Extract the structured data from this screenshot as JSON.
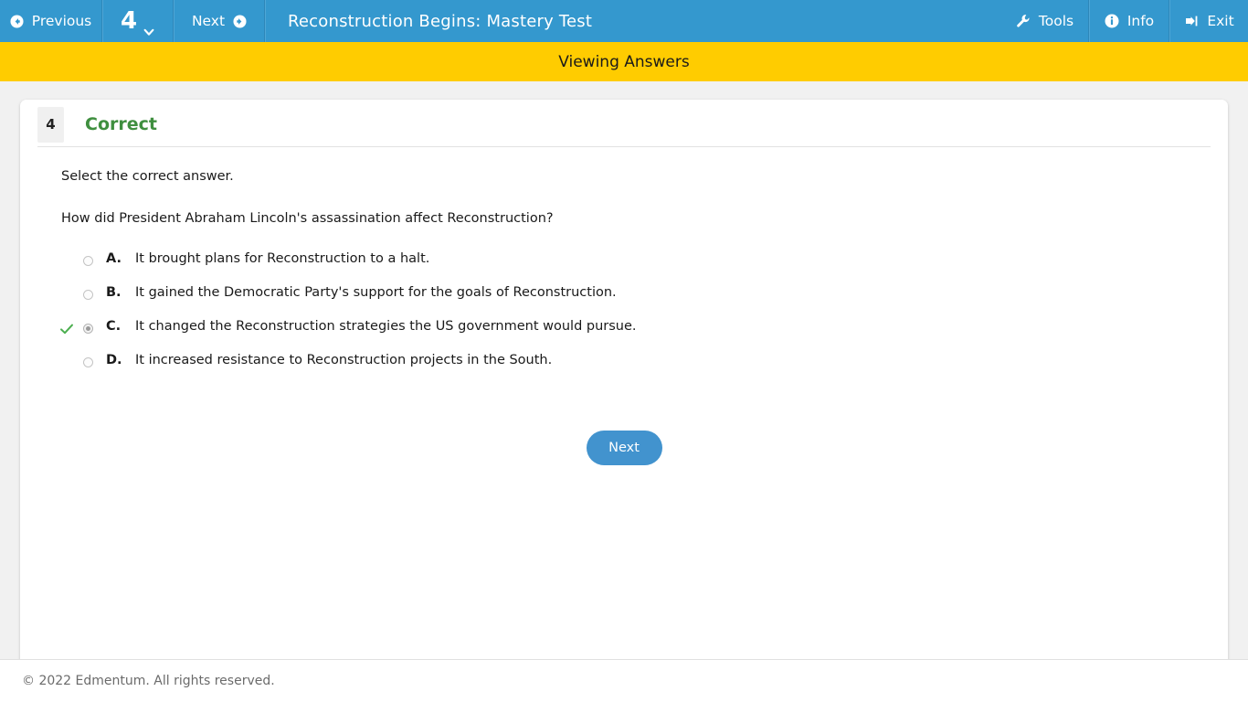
{
  "topbar": {
    "previous_label": "Previous",
    "question_number": "4",
    "next_label": "Next",
    "title": "Reconstruction Begins: Mastery Test",
    "tools_label": "Tools",
    "info_label": "Info",
    "exit_label": "Exit",
    "background_color": "#3498ce"
  },
  "banner": {
    "text": "Viewing Answers",
    "background_color": "#ffcc00"
  },
  "question": {
    "number": "4",
    "status": "Correct",
    "status_color": "#3f8f3f",
    "instruction": "Select the correct answer.",
    "stem": "How did President Abraham Lincoln's assassination affect Reconstruction?",
    "options": [
      {
        "letter": "A.",
        "text": "It brought plans for Reconstruction to a halt.",
        "selected": false,
        "correct": false
      },
      {
        "letter": "B.",
        "text": "It gained the Democratic Party's support for the goals of Reconstruction.",
        "selected": false,
        "correct": false
      },
      {
        "letter": "C.",
        "text": "It changed the Reconstruction strategies the US government would pursue.",
        "selected": true,
        "correct": true
      },
      {
        "letter": "D.",
        "text": "It increased resistance to Reconstruction projects in the South.",
        "selected": false,
        "correct": false
      }
    ],
    "next_button_label": "Next",
    "next_button_color": "#4293ce"
  },
  "footer": {
    "copyright": "© 2022 Edmentum. All rights reserved."
  }
}
